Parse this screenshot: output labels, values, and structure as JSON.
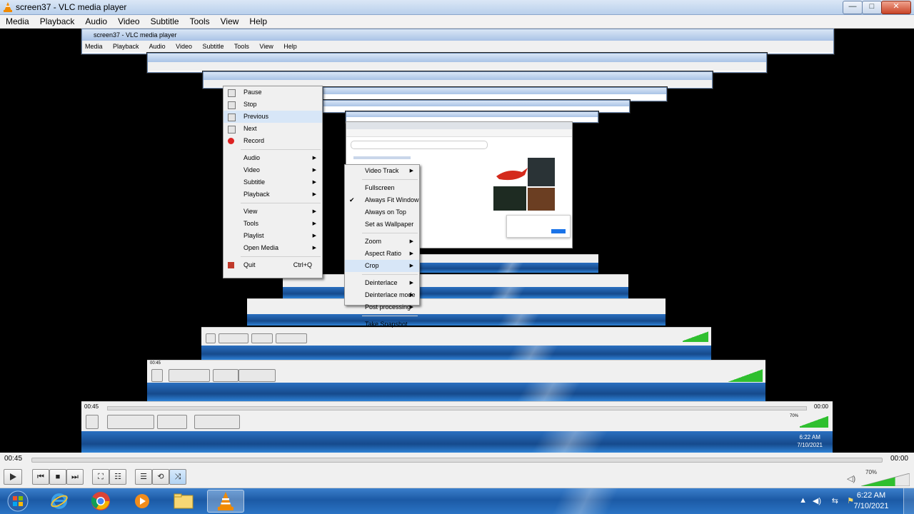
{
  "window": {
    "title": "screen37 - VLC media player",
    "min_glyph": "—",
    "max_glyph": "□",
    "close_glyph": "✕"
  },
  "menubar": [
    "Media",
    "Playback",
    "Audio",
    "Video",
    "Subtitle",
    "Tools",
    "View",
    "Help"
  ],
  "nested": {
    "title": "screen37 - VLC media player",
    "menu_items": [
      "Media",
      "Playback",
      "Audio",
      "Video",
      "Subtitle",
      "Tools",
      "View",
      "Help"
    ],
    "elapsed": "00:45",
    "total": "00:00",
    "volume": "70%",
    "clock_time": "6:22 AM",
    "clock_date": "7/10/2021"
  },
  "context_menu": {
    "items": [
      {
        "label": "Pause",
        "icon": "pause-icon"
      },
      {
        "label": "Stop",
        "icon": "stop-icon"
      },
      {
        "label": "Previous",
        "icon": "previous-icon"
      },
      {
        "label": "Next",
        "icon": "next-icon"
      },
      {
        "label": "Record",
        "icon": "record-icon"
      },
      {
        "label": "Audio",
        "sub": true
      },
      {
        "label": "Video",
        "sub": true
      },
      {
        "label": "Subtitle",
        "sub": true
      },
      {
        "label": "Playback",
        "sub": true
      },
      {
        "label": "View",
        "sub": true
      },
      {
        "label": "Tools",
        "sub": true
      },
      {
        "label": "Playlist",
        "sub": true
      },
      {
        "label": "Open Media",
        "sub": true
      },
      {
        "label": "Quit",
        "shortcut": "Ctrl+Q",
        "icon": "quit-icon"
      }
    ]
  },
  "video_submenu": {
    "items": [
      {
        "label": "Video Track",
        "sub": true
      },
      {
        "label": "Fullscreen"
      },
      {
        "label": "Always Fit Window",
        "checked": true
      },
      {
        "label": "Always on Top"
      },
      {
        "label": "Set as Wallpaper"
      },
      {
        "label": "Zoom",
        "sub": true
      },
      {
        "label": "Aspect Ratio",
        "sub": true
      },
      {
        "label": "Crop",
        "sub": true
      },
      {
        "label": "Deinterlace",
        "sub": true
      },
      {
        "label": "Deinterlace mode",
        "sub": true
      },
      {
        "label": "Post processing",
        "sub": true
      },
      {
        "label": "Take Snapshot"
      }
    ]
  },
  "player": {
    "elapsed": "00:45",
    "total": "00:00",
    "volume": "70%",
    "volume_level": 0.7
  },
  "taskbar": {
    "clock_time": "6:22 AM",
    "clock_date": "7/10/2021",
    "apps": [
      "start-orb-icon",
      "internet-explorer-icon",
      "chrome-icon",
      "media-player-icon",
      "file-explorer-icon",
      "vlc-icon"
    ]
  }
}
